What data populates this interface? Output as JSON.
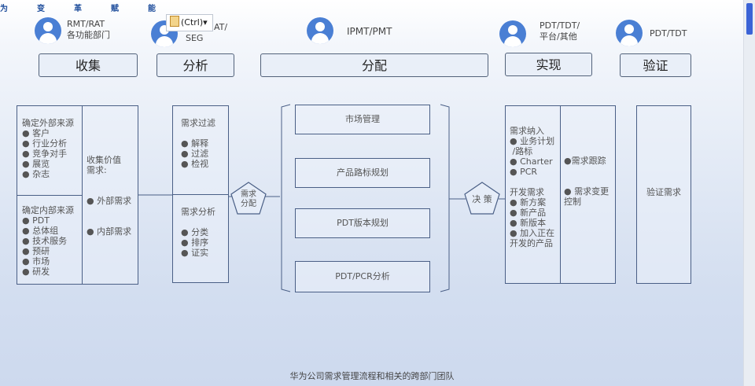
{
  "top_title": [
    "为",
    "变",
    "革",
    "赋",
    "能"
  ],
  "paste_options": {
    "label": "(Ctrl)",
    "arrow": "▾"
  },
  "roles": [
    {
      "line1": "RMT/RAT",
      "line2": "各功能部门"
    },
    {
      "line1": "AT/",
      "line2": "SEG"
    },
    {
      "line1": "IPMT/PMT",
      "line2": ""
    },
    {
      "line1": "PDT/TDT/",
      "line2": "平台/其他"
    },
    {
      "line1": "PDT/TDT",
      "line2": ""
    }
  ],
  "stages": [
    "收集",
    "分析",
    "分配",
    "实现",
    "验证"
  ],
  "collect": {
    "external": "确定外部来源\n● 客户\n● 行业分析\n● 竞争对手\n● 展览\n● 杂志",
    "internal": "确定内部来源\n● PDT\n● 总体组\n● 技术服务\n● 预研\n● 市场\n● 研发",
    "value": "收集价值\n需求:\n\n\n● 外部需求\n\n\n● 内部需求"
  },
  "analyze": {
    "filter": "需求过滤\n\n● 解释\n● 过滤\n● 检视",
    "analysis": "需求分析\n\n● 分类\n● 排序\n● 证实"
  },
  "pentagon1": {
    "line1": "需求",
    "line2": "分配"
  },
  "distribute": [
    "市场管理",
    "产品路标规划",
    "PDT版本规划",
    "PDT/PCR分析"
  ],
  "pentagon2": "决 策",
  "realize": {
    "left": "需求纳入\n● 业务计划\n /路标\n● Charter\n● PCR\n\n开发需求\n● 新方案\n● 新产品\n● 新版本\n● 加入正在\n开发的产品",
    "right": "●需求跟踪\n\n\n● 需求变更\n控制"
  },
  "verify": "验证需求",
  "caption": "华为公司需求管理流程和相关的跨部门团队",
  "colors": {
    "avatar": "#4a7fd4",
    "border": "#4a5f86",
    "title": "#1f4e9c",
    "scroll_thumb": "#3b63d6"
  }
}
